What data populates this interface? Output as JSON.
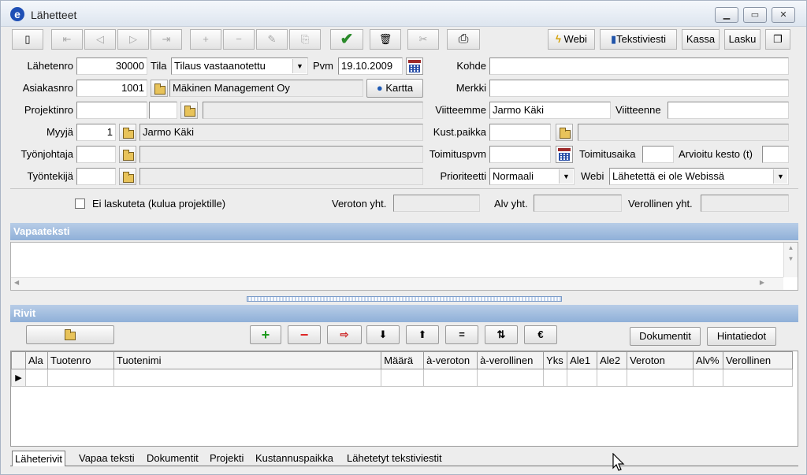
{
  "window": {
    "title": "Lähetteet",
    "logo": "e",
    "minimize": "▁",
    "maximize": "▭",
    "close": "✕"
  },
  "toolbar": {
    "nav_icons": [
      "document-icon",
      "first-record-icon",
      "prev-record-icon",
      "next-record-icon",
      "last-record-icon",
      "add-record-icon",
      "delete-record-icon",
      "edit-record-icon",
      "copy-record-icon",
      "confirm-icon",
      "trash-icon",
      "link-icon",
      "print-icon"
    ],
    "glyphs": {
      "first": "⇤",
      "prev": "◁",
      "next": "▷",
      "last": "⇥",
      "add": "+",
      "remove": "−",
      "edit": "✎",
      "copy": "⎘",
      "confirm": "✔",
      "trash": "🗑",
      "link": "✂",
      "print": "⎙",
      "doc": "▯",
      "restore": "❐"
    },
    "webi": "Webi",
    "tekstiviesti": "Tekstiviesti",
    "kassa": "Kassa",
    "lasku": "Lasku"
  },
  "form": {
    "lahetenro_label": "Lähetenro",
    "lahetenro": "30000",
    "tila_label": "Tila",
    "tila": "Tilaus vastaanotettu",
    "pvm_label": "Pvm",
    "pvm": "19.10.2009",
    "kohde_label": "Kohde",
    "kohde": "",
    "asiakasnro_label": "Asiakasnro",
    "asiakasnro": "1001",
    "asiakas_nimi": "Mäkinen Management Oy",
    "kartta": "Kartta",
    "merkki_label": "Merkki",
    "merkki": "",
    "projektinro_label": "Projektinro",
    "viitteemme_label": "Viitteemme",
    "viitteemme": "Jarmo Käki",
    "viitteenne_label": "Viitteenne",
    "viitteenne": "",
    "myyja_label": "Myyjä",
    "myyja_nro": "1",
    "myyja_nimi": "Jarmo Käki",
    "kustpaikka_label": "Kust.paikka",
    "tyonjohtaja_label": "Työnjohtaja",
    "toimituspvm_label": "Toimituspvm",
    "toimitusaika_label": "Toimitusaika",
    "arvioitu_label": "Arvioitu kesto (t)",
    "tyontekija_label": "Työntekijä",
    "prioriteetti_label": "Prioriteetti",
    "prioriteetti": "Normaali",
    "webi_label": "Webi",
    "webi_status": "Lähetettä ei ole Webissä",
    "ei_laskuteta": "Ei laskuteta (kulua projektille)",
    "veroton_label": "Veroton yht.",
    "alv_label": "Alv yht.",
    "verollinen_label": "Verollinen yht."
  },
  "vapaateksti": {
    "header": "Vapaateksti",
    "text": ""
  },
  "rivit": {
    "header": "Rivit",
    "buttons": {
      "plus": "+",
      "minus": "−",
      "export": "⇨",
      "down": "⬇",
      "up": "⬆",
      "equals": "=",
      "sort": "⇅",
      "euro": "€"
    },
    "dokumentit": "Dokumentit",
    "hintatiedot": "Hintatiedot",
    "columns": [
      "Ala",
      "Tuotenro",
      "Tuotenimi",
      "Määrä",
      "à-veroton",
      "à-verollinen",
      "Yks",
      "Ale1",
      "Ale2",
      "Veroton",
      "Alv%",
      "Verollinen"
    ],
    "row_marker": "▶"
  },
  "tabs": [
    "Läheterivit",
    "Vapaa teksti",
    "Dokumentit",
    "Projekti",
    "Kustannuspaikka",
    "Lähetetyt tekstiviestit"
  ],
  "colors": {
    "section_header": "#8fb0d8",
    "confirm": "#2a8a2a",
    "plus": "#1d9a1d",
    "minus": "#d22"
  }
}
